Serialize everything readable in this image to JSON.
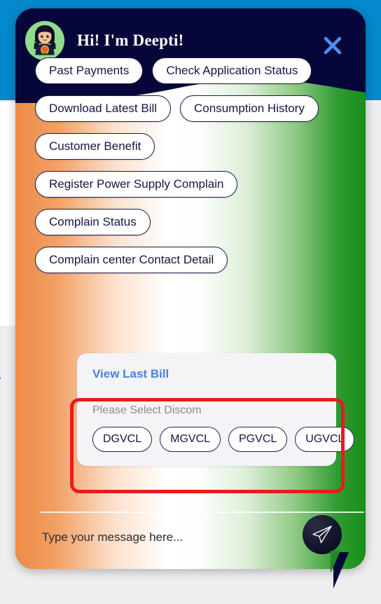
{
  "background_page": {
    "partial_link_text": "lar"
  },
  "widget": {
    "header": {
      "bot_name": "Hi! I'm Deepti!",
      "avatar_icon": "female-agent-avatar-icon",
      "close_icon": "close-x-icon",
      "close_color": "#4d8ff0",
      "background_color": "#07063a"
    },
    "quick_replies": {
      "rows": [
        [
          "Past Payments",
          "Check Application Status"
        ],
        [
          "Download Latest Bill",
          "Consumption History"
        ],
        [
          "Customer Benefit"
        ],
        [
          "Register Power Supply Complain"
        ],
        [
          "Complain Status"
        ],
        [
          "Complain center Contact Detail"
        ]
      ]
    },
    "bot_message": {
      "link_label": "View Last Bill",
      "prompt": "Please Select Discom",
      "discoms": [
        "DGVCL",
        "MGVCL",
        "PGVCL",
        "UGVCL"
      ]
    },
    "annotation": {
      "highlight_color": "#e81c1c",
      "target": "discom-selection-area"
    },
    "composer": {
      "placeholder": "Type your message here...",
      "value": "",
      "send_icon": "send-paper-plane-icon"
    },
    "theme": {
      "gradient_start": "#ef8b45",
      "gradient_mid": "#ffffff",
      "gradient_end": "#169016",
      "chip_text": "#151646",
      "link_blue": "#4b7fdc",
      "page_bar_blue": "#0589cd"
    }
  }
}
